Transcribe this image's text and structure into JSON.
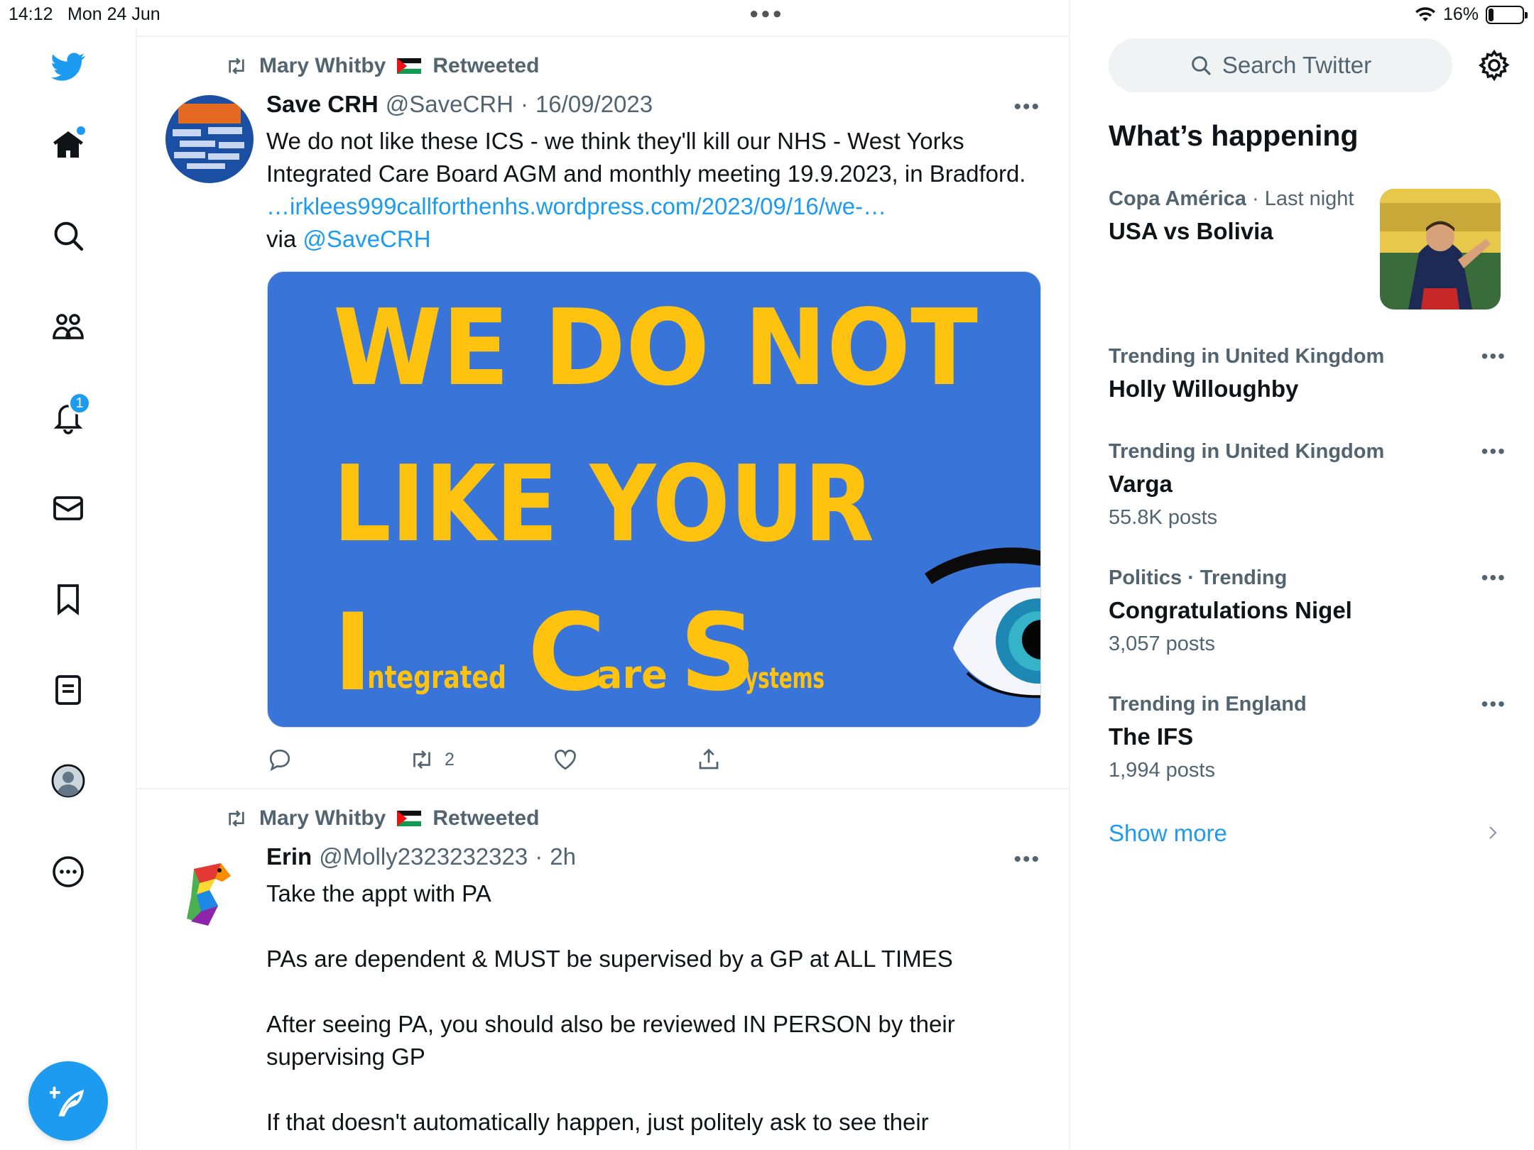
{
  "status_bar": {
    "time": "14:12",
    "date": "Mon 24 Jun",
    "battery": "16%",
    "battery_level": 0.16
  },
  "nav": {
    "items": [
      "home",
      "explore",
      "communities",
      "notifications",
      "messages",
      "bookmarks",
      "lists",
      "profile",
      "more"
    ],
    "notifications_count": "1"
  },
  "tweets": [
    {
      "retweeted_by": "Mary Whitby",
      "retweet_label": "Retweeted",
      "name": "Save CRH",
      "handle": "@SaveCRH",
      "date": "16/09/2023",
      "text_1": "We do not like these ICS - we think they'll kill our NHS - West Yorks Integrated Care Board AGM and monthly meeting 19.9.2023, in Bradford. ",
      "link": "…irklees999callforthenhs.wordpress.com/2023/09/16/we-…",
      "text_2": "via ",
      "mention": "@SaveCRH",
      "media": {
        "line1": "WE DO NOT",
        "line2": "LIKE YOUR",
        "i_big": "I",
        "i_small": "ntegrated",
        "c_big": "C",
        "c_small": "are",
        "s_big": "S",
        "s_small": "ystems"
      },
      "retweets": "2"
    },
    {
      "retweeted_by": "Mary Whitby",
      "retweet_label": "Retweeted",
      "name": "Erin",
      "handle": "@Molly2323232323",
      "date": "2h",
      "text": "Take the appt with PA\n\nPAs are dependent & MUST be supervised by a GP at ALL TIMES\n\nAfter seeing PA, you should also be reviewed IN PERSON by their supervising GP\n\nIf that doesn't automatically happen, just politely ask to see their"
    }
  ],
  "sidebar": {
    "search_placeholder": "Search Twitter",
    "title": "What’s happening",
    "trends": [
      {
        "context": "Copa América",
        "context_light": " · Last night",
        "title": "USA vs Bolivia",
        "count": ""
      },
      {
        "context": "Trending in United Kingdom",
        "context_light": "",
        "title": "Holly Willoughby",
        "count": ""
      },
      {
        "context": "Trending in United Kingdom",
        "context_light": "",
        "title": "Varga",
        "count": "55.8K posts"
      },
      {
        "context": "Politics · Trending",
        "context_light": "",
        "title": "Congratulations Nigel",
        "count": "3,057 posts"
      },
      {
        "context": "Trending in England",
        "context_light": "",
        "title": "The IFS",
        "count": "1,994 posts"
      }
    ],
    "show_more": "Show more"
  },
  "colors": {
    "accent": "#1d9bf0",
    "media_bg": "#3975d8",
    "media_text": "#ffc20e"
  }
}
